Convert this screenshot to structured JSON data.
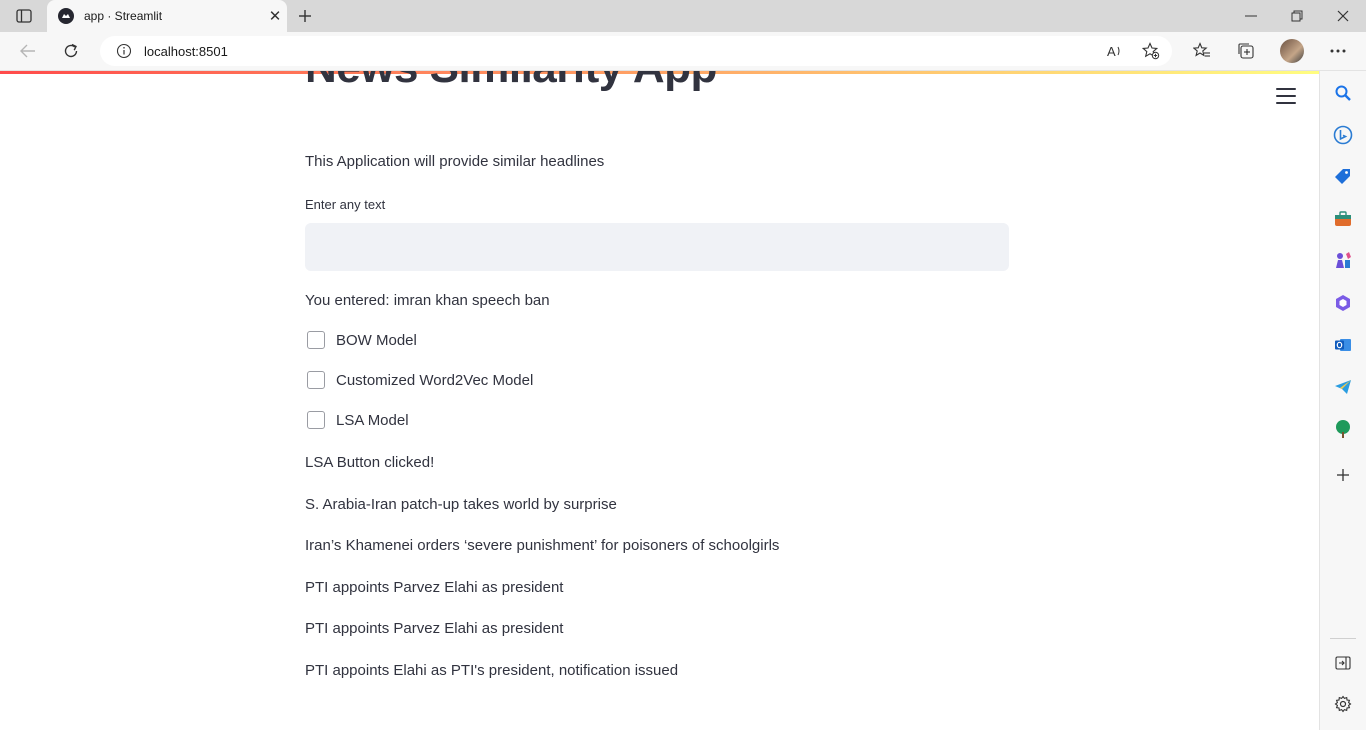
{
  "browser": {
    "tab_title": "app · Streamlit",
    "tab_close": "✕",
    "new_tab": "+",
    "url": "localhost:8501"
  },
  "page": {
    "title": "News Similarity App",
    "description": "This Application will provide similar headlines",
    "input_label": "Enter any text",
    "input_value": "",
    "entered_text": "You entered: imran khan speech ban",
    "checkboxes": [
      {
        "label": "BOW Model",
        "checked": false
      },
      {
        "label": "Customized Word2Vec Model",
        "checked": false
      },
      {
        "label": "LSA Model",
        "checked": false
      }
    ],
    "status_message": "LSA Button clicked!",
    "results": [
      "S. Arabia-Iran patch-up takes world by surprise",
      "Iran’s Khamenei orders ‘severe punishment’ for poisoners of schoolgirls",
      "PTI appoints Parvez Elahi as president",
      "PTI appoints Parvez Elahi as president",
      "PTI appoints Elahi as PTI's president, notification issued"
    ]
  },
  "colors": {
    "streamlit_text": "#31333f",
    "input_bg": "#f0f2f6",
    "decoration_start": "#ff4b4b",
    "decoration_end": "#fffd80"
  },
  "icons": {
    "tab_actions": "tab-actions-icon",
    "back": "back-arrow-icon",
    "reload": "reload-icon",
    "site_info": "info-icon",
    "read_aloud": "read-aloud-icon",
    "add_favorite": "add-favorite-icon",
    "favorites": "favorites-icon",
    "collections": "collections-icon",
    "more": "more-icon",
    "menu": "hamburger-menu-icon"
  }
}
